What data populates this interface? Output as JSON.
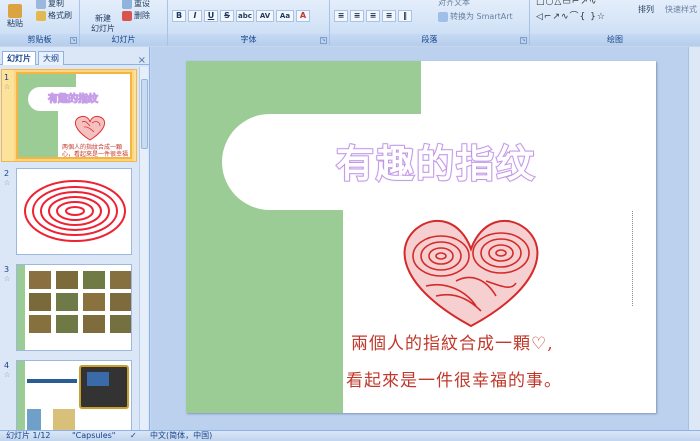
{
  "ribbon": {
    "clipboard": {
      "paste": "粘贴",
      "copy": "复制",
      "format_painter": "格式刷",
      "label": "剪贴板"
    },
    "slides": {
      "new_slide": "新建\n幻灯片",
      "reset": "重设",
      "delete": "删除",
      "label": "幻灯片"
    },
    "font": {
      "label": "字体",
      "buttons": [
        "B",
        "I",
        "U",
        "S",
        "abc",
        "AV",
        "Aa",
        "A"
      ]
    },
    "paragraph": {
      "label": "段落",
      "align_text": "对齐文本",
      "convert_smartart": "转换为 SmartArt"
    },
    "drawing": {
      "label": "绘图",
      "arrange": "排列",
      "quick_styles": "快速样式",
      "shapes": "◁⌐↗∿⌒{ }☆"
    }
  },
  "left_pane": {
    "tabs": [
      "幻灯片",
      "大纲"
    ],
    "close": "×",
    "slides": [
      {
        "num": "1",
        "star": "☆",
        "title": "有趣的指纹"
      },
      {
        "num": "2",
        "star": "☆"
      },
      {
        "num": "3",
        "star": "☆"
      },
      {
        "num": "4",
        "star": "☆"
      }
    ],
    "slide1_caption": "两個人的指紋合成一顆心，看起來是一件很幸福的事。"
  },
  "slide": {
    "title": "有趣的指纹",
    "line1": "兩個人的指紋合成一顆♡,",
    "line2": "看起來是一件很幸福的事。"
  },
  "status": {
    "slide_count": "幻灯片 1/12",
    "theme": "\"Capsules\"",
    "language": "中文(简体，中国)"
  },
  "colors": {
    "accent_green": "#9ccc95",
    "title_outline": "#c69ee8",
    "ink_red": "#c0392b"
  }
}
